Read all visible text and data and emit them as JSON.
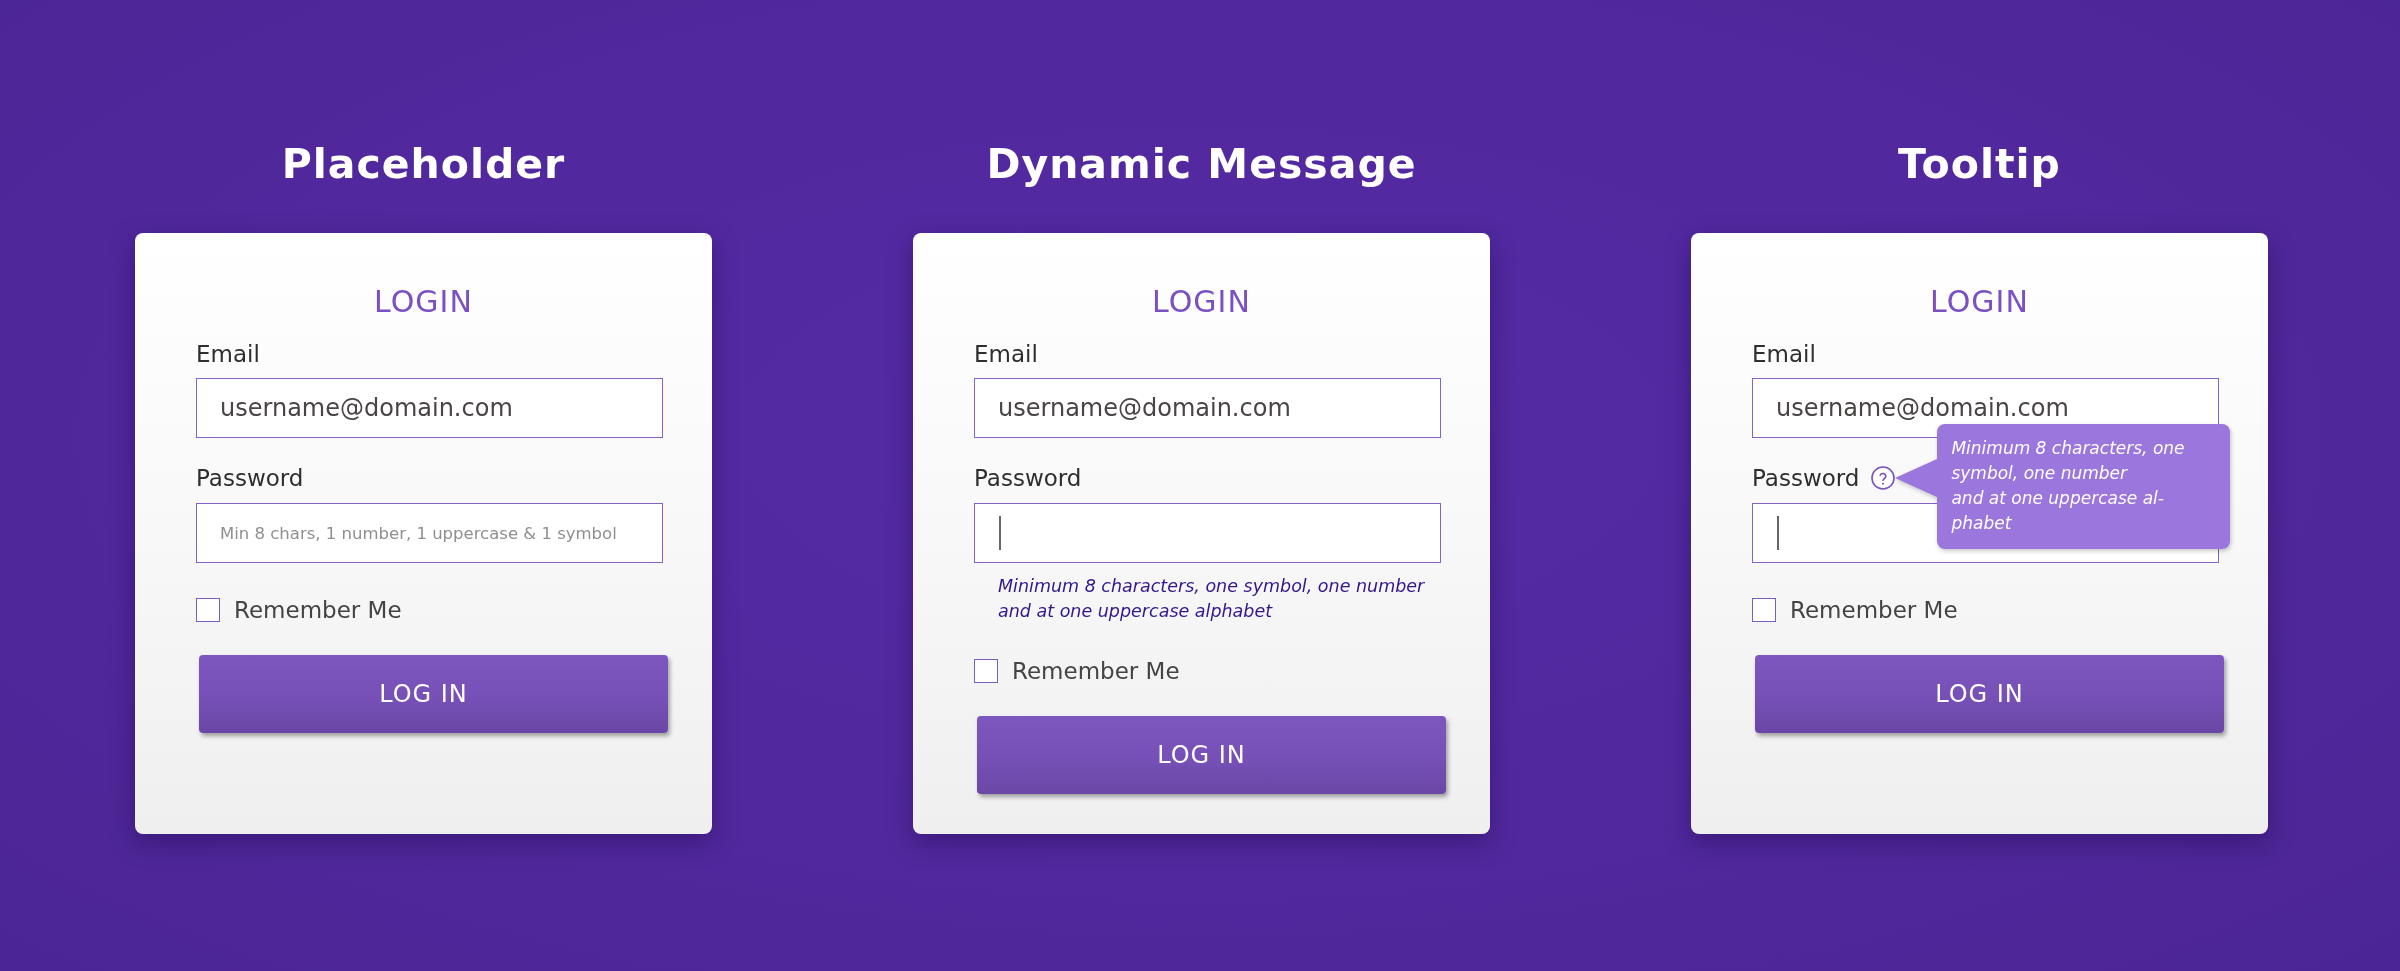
{
  "panels": [
    {
      "title": "Placeholder",
      "card": {
        "heading": "LOGIN",
        "email": {
          "label": "Email",
          "value": "username@domain.com"
        },
        "password": {
          "label": "Password",
          "placeholder": "Min 8 chars, 1 number, 1 uppercase & 1 symbol",
          "focused": false
        },
        "remember": {
          "label": "Remember Me",
          "checked": false
        },
        "button": "LOG IN"
      }
    },
    {
      "title": "Dynamic Message",
      "card": {
        "heading": "LOGIN",
        "email": {
          "label": "Email",
          "value": "username@domain.com"
        },
        "password": {
          "label": "Password",
          "focused": true,
          "hint": "Minimum 8 characters, one symbol, one number\nand at one uppercase alphabet"
        },
        "remember": {
          "label": "Remember Me",
          "checked": false
        },
        "button": "LOG IN"
      }
    },
    {
      "title": "Tooltip",
      "card": {
        "heading": "LOGIN",
        "email": {
          "label": "Email",
          "value": "username@domain.com"
        },
        "password": {
          "label": "Password",
          "focused": true,
          "tooltip": "Minimum 8 characters, one\nsymbol, one number\nand at one uppercase al-\nphabet"
        },
        "remember": {
          "label": "Remember Me",
          "checked": false
        },
        "button": "LOG IN"
      }
    }
  ]
}
